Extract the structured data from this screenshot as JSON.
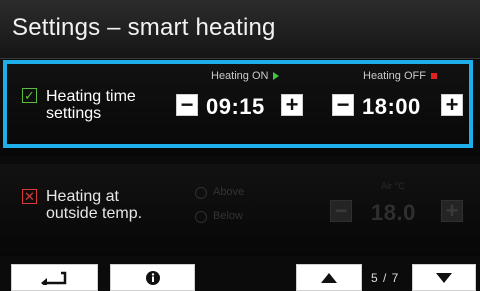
{
  "header": {
    "title": "Settings – smart heating"
  },
  "heating_time": {
    "enabled": true,
    "label_line1": "Heating time",
    "label_line2": "settings",
    "on": {
      "label": "Heating ON",
      "value": "09:15",
      "decrement": "−",
      "increment": "+"
    },
    "off": {
      "label": "Heating OFF",
      "value": "18:00",
      "decrement": "−",
      "increment": "+"
    }
  },
  "outside_temp": {
    "enabled": false,
    "label_line1": "Heating at",
    "label_line2": "outside temp.",
    "options": [
      "Above",
      "Below"
    ],
    "air_label": "Air °C",
    "value": "18.0",
    "decrement": "−",
    "increment": "+"
  },
  "nav": {
    "page": "5 / 7"
  },
  "colors": {
    "highlight": "#1eaee9",
    "check_green": "#5bbd3c",
    "check_red": "#d83a3a",
    "on_arrow": "#3ec63e",
    "off_square": "#e02222"
  },
  "icons": [
    "check-icon",
    "x-icon",
    "play-arrow-icon",
    "stop-square-icon",
    "back-arrow-icon",
    "info-icon",
    "up-arrow-icon",
    "down-arrow-icon"
  ]
}
